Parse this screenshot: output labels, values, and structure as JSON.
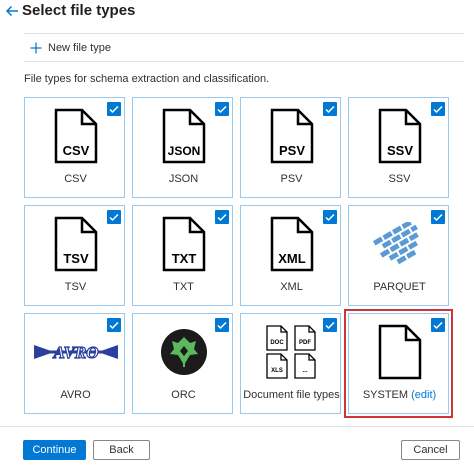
{
  "header": {
    "title": "Select file types",
    "back_icon": "arrow-left-icon"
  },
  "toolbar": {
    "new_file_type_label": "New file type",
    "icon": "plus-icon"
  },
  "description": "File types for schema extraction and classification.",
  "tiles": [
    {
      "label": "CSV",
      "badge": "CSV",
      "checked": true
    },
    {
      "label": "JSON",
      "badge": "JSON",
      "checked": true
    },
    {
      "label": "PSV",
      "badge": "PSV",
      "checked": true
    },
    {
      "label": "SSV",
      "badge": "SSV",
      "checked": true
    },
    {
      "label": "TSV",
      "badge": "TSV",
      "checked": true
    },
    {
      "label": "TXT",
      "badge": "TXT",
      "checked": true
    },
    {
      "label": "XML",
      "badge": "XML",
      "checked": true
    },
    {
      "label": "PARQUET",
      "checked": true
    },
    {
      "label": "AVRO",
      "logo_text": "AVRO",
      "checked": true
    },
    {
      "label": "ORC",
      "checked": true
    },
    {
      "label": "Document file types",
      "badges": [
        "DOC",
        "PDF",
        "XLS",
        "..."
      ],
      "checked": true
    },
    {
      "label": "SYSTEM",
      "edit_label": "(edit)",
      "checked": true,
      "highlighted": true
    }
  ],
  "footer": {
    "continue_label": "Continue",
    "back_label": "Back",
    "cancel_label": "Cancel"
  },
  "colors": {
    "accent": "#0078d4",
    "tile_border": "#9ac9ef",
    "highlight": "#d13438",
    "parquet": "#5b9bd5",
    "orc_bg": "#1b1b1b",
    "orc_leaf": "#5cb85c",
    "avro": "#2a3f9e"
  }
}
